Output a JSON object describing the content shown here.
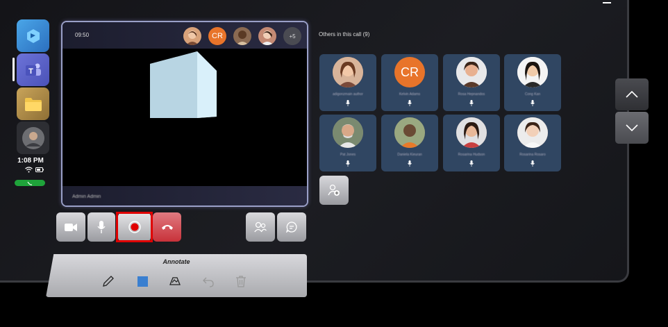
{
  "window": {
    "title": ""
  },
  "app_bar": {
    "apps": [
      {
        "name": "Bookings",
        "icon": "bookings-icon"
      },
      {
        "name": "Teams",
        "icon": "teams-icon"
      },
      {
        "name": "Files",
        "icon": "folder-icon"
      },
      {
        "name": "Profile",
        "icon": "avatar"
      }
    ],
    "time": "1:08 PM"
  },
  "video": {
    "timer": "09:50",
    "participants": [
      {
        "initials": "",
        "color": "#d8a27a"
      },
      {
        "initials": "CR",
        "color": "#e8742a"
      },
      {
        "initials": "",
        "color": "#8a6a52"
      },
      {
        "initials": "",
        "color": "#c48a74"
      }
    ],
    "overflow": "+5",
    "presenter_name": "Admin Admin"
  },
  "controls": {
    "camera": "video-camera-icon",
    "mic": "microphone-icon",
    "record": "record-icon",
    "hangup": "hang-up-icon",
    "people": "people-icon",
    "chat": "chat-icon"
  },
  "annotate": {
    "title": "Annotate",
    "tools": [
      "pen-icon",
      "shape-icon",
      "highlighter-icon",
      "undo-icon",
      "trash-icon"
    ],
    "colors": {
      "shape": "#3a7fd0"
    }
  },
  "others": {
    "label": "Others in this call (9)",
    "people": [
      {
        "name": "adigonzmain author",
        "initials": "",
        "color": "#c99070"
      },
      {
        "name": "Kelvin Adams",
        "initials": "CR",
        "color": "#e8742a"
      },
      {
        "name": "Rosa Hepnandos",
        "initials": "",
        "color": "#d09a80"
      },
      {
        "name": "Cong Kan",
        "initials": "",
        "color": "#c8a07a"
      },
      {
        "name": "Pat Jones",
        "initials": "",
        "color": "#a89080"
      },
      {
        "name": "Daniela Kieuran",
        "initials": "",
        "color": "#8a6a52"
      },
      {
        "name": "Rosarina Hudson",
        "initials": "",
        "color": "#b07c5e"
      },
      {
        "name": "Rosarina Rosaro",
        "initials": "",
        "color": "#c48a74"
      }
    ]
  },
  "colors": {
    "tile_bg": "#304662",
    "record": "#e00000",
    "hangup": "#c8323a"
  }
}
